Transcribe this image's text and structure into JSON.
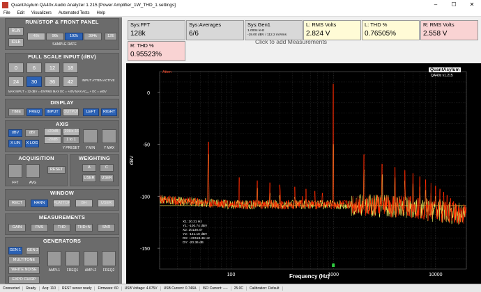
{
  "window": {
    "title": "QuantAsylum QA40x Audio Analyzer 1.215 [Power Amplifier_1W_THD_1.settings]",
    "minimize": "–",
    "maximize": "☐",
    "close": "✕"
  },
  "menu": [
    "File",
    "Edit",
    "Visualizers",
    "Automated Tests",
    "Help"
  ],
  "panel": {
    "run_stop": {
      "header": "RUN/STOP & FRONT PANEL",
      "run": "RUN",
      "idle": "IDLE",
      "rates": [
        "48k",
        "96k",
        "192k",
        "384k"
      ],
      "rate_selected": "192k",
      "extra": "12E",
      "sample_rate_label": "SAMPLE RATE"
    },
    "full_scale": {
      "header": "FULL SCALE INPUT (dBV)",
      "values": [
        "0",
        "6",
        "12",
        "18",
        "24",
        "30",
        "36",
        "42"
      ],
      "selected": "30",
      "atten_note": "INPUT ATTEN ACTIVE",
      "max_input": "MAX INPUT = 32 dBV = 40VRMS   MAX DC = +40V   MAX ACₚₚ + DC = ±60V"
    },
    "display": {
      "header": "DISPLAY",
      "buttons": [
        "TIME",
        "FREQ",
        "INPUT",
        "OUTPUT",
        "LEFT",
        "RIGHT"
      ]
    },
    "axis": {
      "header": "AXIS",
      "dbv": "dBV",
      "dbr": "dBr",
      "plus20": "+20dB",
      "minus20": "-20dB",
      "xlin": "X LIN",
      "xlog": "X LOG",
      "zoom_a": "[20Hz-16k]",
      "zoom_b": "1 to 1",
      "y_preset": "Y PRESET",
      "y_min": "Y MIN",
      "y_max": "Y MAX"
    },
    "acquisition": {
      "header": "ACQUISITION",
      "reset": "RESET",
      "fft": "FFT",
      "avg": "AVG"
    },
    "weighting": {
      "header": "WEIGHTING",
      "a": "A",
      "c": "C",
      "user1": "USER",
      "user2": "USER"
    },
    "window": {
      "header": "WINDOW",
      "buttons": [
        "RECT",
        "HANN",
        "FLATTOP",
        "BH",
        "USER"
      ],
      "selected": "HANN"
    },
    "measurements": {
      "header": "MEASUREMENTS",
      "buttons": [
        "GAIN",
        "FMS",
        "THD",
        "THD+N",
        "SNR"
      ]
    },
    "generators": {
      "header": "GENERATORS",
      "gen1": "GEN 1",
      "gen2": "GEN 2",
      "multitone": "MULTITONE",
      "white_noise": "WHITE NOISE",
      "expo_chirp": "EXPO CHIRP",
      "ampl1": "AMPL1",
      "freq1": "FREQ1",
      "ampl2": "AMPL2",
      "freq2": "FREQ2"
    }
  },
  "tiles": [
    {
      "title": "Sys:FFT",
      "value": "128k",
      "style": "grey"
    },
    {
      "title": "Sys:Averages",
      "value": "6/6",
      "style": "grey"
    },
    {
      "title": "Sys:Gen1",
      "value": "",
      "line1": "1.0004 kHz",
      "line2": "-19.00 dBV  / 112.2 mVrms",
      "style": "grey gen"
    },
    {
      "title": "L: RMS Volts",
      "value": "2.824 V",
      "style": "yellow"
    },
    {
      "title": "L: THD %",
      "value": "0.76505%",
      "style": "yellow"
    },
    {
      "title": "R: RMS Volts",
      "value": "2.558 V",
      "style": "pink"
    },
    {
      "title": "R: THD %",
      "value": "0.95523%",
      "style": "pink"
    }
  ],
  "click_to_add": "Click to add Measurements",
  "plot": {
    "atten": "Atten",
    "logo_main": "QuantAsylum",
    "logo_sub": "QA40x v1.215",
    "ylabel": "dBV",
    "xlabel": "Frequency (Hz)",
    "y_ticks": [
      "0",
      "-50",
      "-100",
      "-150"
    ],
    "x_ticks": [
      "100",
      "1000",
      "10000"
    ],
    "cursor_readout": [
      "X1: 20.21 Hz",
      "Y1: -100.74 dBV",
      "X2: 20138.67",
      "Y2: -121.10 dBV",
      "DX: +20118.46 Hz",
      "DY: -20.36 dB"
    ]
  },
  "chart_data": {
    "type": "line",
    "title": "",
    "xlabel": "Frequency (Hz)",
    "ylabel": "dBV",
    "xscale": "log",
    "xlim": [
      20,
      20000
    ],
    "ylim": [
      -170,
      20
    ],
    "grid": true,
    "series": [
      {
        "color": "#ff2a00",
        "points": [
          [
            20,
            -103
          ],
          [
            50,
            -108
          ],
          [
            60,
            -48
          ],
          [
            100,
            -120
          ],
          [
            120,
            -82
          ],
          [
            180,
            -86
          ],
          [
            300,
            -95
          ],
          [
            500,
            -100
          ],
          [
            1000,
            8
          ],
          [
            2000,
            -60
          ],
          [
            3000,
            -70
          ],
          [
            5000,
            -95
          ],
          [
            10000,
            -118
          ],
          [
            20000,
            -125
          ]
        ]
      },
      {
        "color": "#e8e85a",
        "points": [
          [
            20,
            -100
          ],
          [
            50,
            -105
          ],
          [
            60,
            -60
          ],
          [
            100,
            -108
          ],
          [
            180,
            -92
          ],
          [
            1000,
            -50
          ],
          [
            2000,
            -75
          ],
          [
            5000,
            -98
          ],
          [
            10000,
            -102
          ],
          [
            20000,
            -115
          ]
        ]
      }
    ]
  },
  "status": {
    "connected": "Connected",
    "ready": "Ready",
    "acq": "Acq: 110",
    "rest": "REST server ready",
    "firmware": "Firmware: 60",
    "usb_voltage": "USB Voltage: 4.675V",
    "usb_current": "USB Current: 0.746A",
    "iso_current": "ISO Current: ----",
    "temp": "25.0C",
    "calibration": "Calibration: Default"
  },
  "colors": {
    "accent_blue": "#2c62b5",
    "trace_left": "#e8e85a",
    "trace_right": "#ff2a00",
    "panel": "#7a7a7a"
  }
}
